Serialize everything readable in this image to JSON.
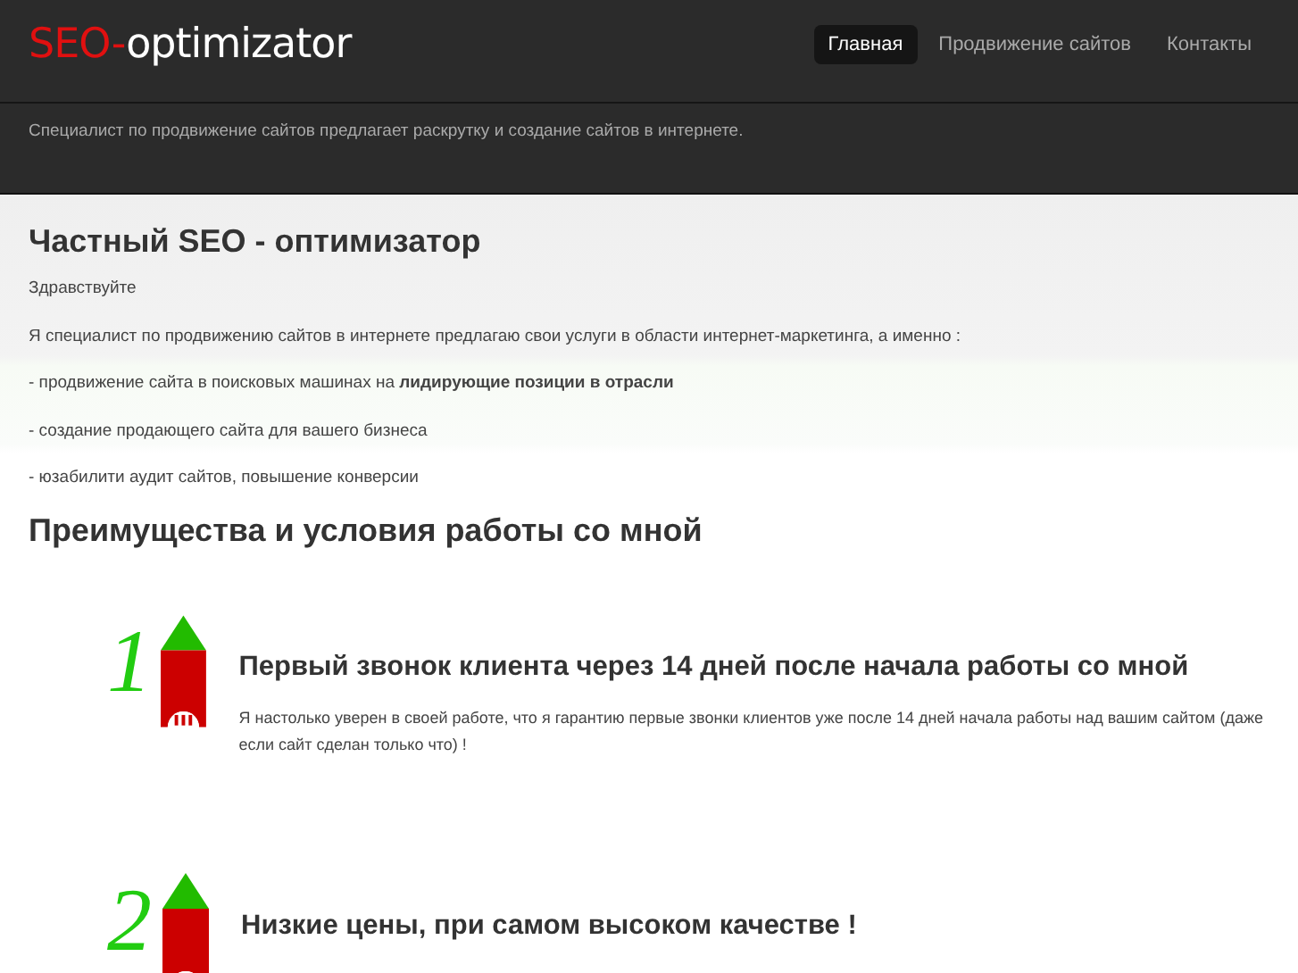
{
  "logo": {
    "brand": "SEO-",
    "name": "optimizator"
  },
  "nav": [
    {
      "label": "Главная",
      "selected": true
    },
    {
      "label": "Продвижение сайтов",
      "selected": false
    },
    {
      "label": "Контакты",
      "selected": false
    }
  ],
  "tagline": "Специалист по продвижение сайтов предлагает раскрутку и создание сайтов в интернете.",
  "title": "Частный SEO - оптимизатор",
  "paragraphs": [
    "Здравствуйте",
    "Я специалист по продвижению сайтов в интернете предлагаю свои услуги в области интернет-маркетинга, а именно :",
    "- продвижение сайта в поисковых машинах на **лидирующие позиции в отрасли**",
    "- создание продающего сайта для вашего бизнеса",
    "- юзабилити аудит сайтов, повышение конверсии"
  ],
  "advantages_title": "Преимущества и условия работы со  мной",
  "advantages": [
    {
      "number": "1",
      "title": "Первый звонок клиента через 14 дней после начала работы со мной",
      "text": "Я настолько уверен в своей работе, что я гарантию первые звонки клиентов уже после 14 дней начала работы над вашим сайтом (даже если сайт сделан только что) !"
    },
    {
      "number": "2",
      "title": "Низкие  цены, при самом высоком качестве !"
    }
  ]
}
